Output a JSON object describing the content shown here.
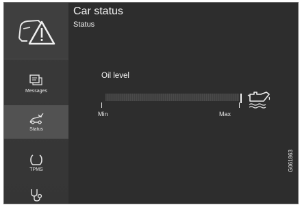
{
  "header": {
    "title": "Car status",
    "subtitle": "Status"
  },
  "sidebar": {
    "items": [
      {
        "label": "Messages",
        "icon": "messages-icon"
      },
      {
        "label": "Status",
        "icon": "status-icon",
        "active": true
      },
      {
        "label": "TPMS",
        "icon": "tpms-icon"
      }
    ]
  },
  "oil": {
    "label": "Oil level",
    "min_label": "Min",
    "max_label": "Max",
    "level_fraction": 0
  },
  "figure_code": "G061863",
  "colors": {
    "background": "#2d2d2d",
    "text": "#f4f4f4",
    "active_item": "#525252"
  }
}
